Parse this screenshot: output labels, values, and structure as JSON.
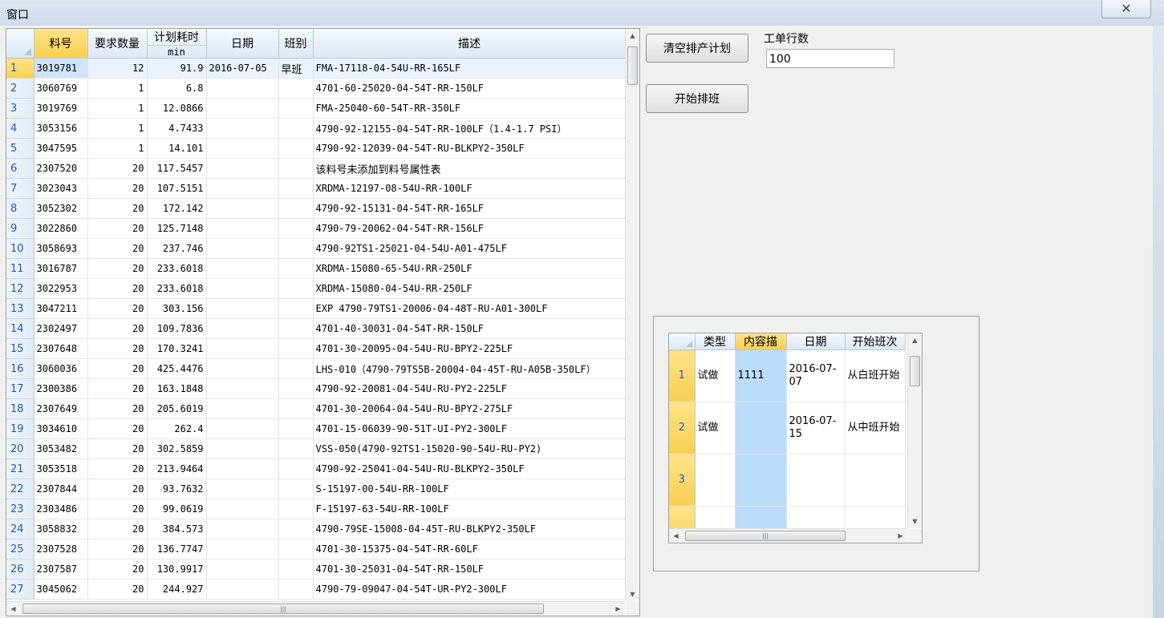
{
  "window": {
    "title": "窗口",
    "close_glyph": "✕"
  },
  "grid": {
    "headers": {
      "code": "料号",
      "qty": "要求数量",
      "time_top": "计划耗时",
      "time_unit": "min",
      "date": "日期",
      "shift": "班别",
      "desc": "描述"
    },
    "rows": [
      {
        "n": "1",
        "code": "3019781",
        "qty": "12",
        "time": "91.9",
        "date": "2016-07-05",
        "shift": "早班",
        "desc": "FMA-17118-04-54U-RR-165LF"
      },
      {
        "n": "2",
        "code": "3060769",
        "qty": "1",
        "time": "6.8",
        "date": "",
        "shift": "",
        "desc": "4701-60-25020-04-54T-RR-150LF"
      },
      {
        "n": "3",
        "code": "3019769",
        "qty": "1",
        "time": "12.0866",
        "date": "",
        "shift": "",
        "desc": "FMA-25040-60-54T-RR-350LF"
      },
      {
        "n": "4",
        "code": "3053156",
        "qty": "1",
        "time": "4.7433",
        "date": "",
        "shift": "",
        "desc": "4790-92-12155-04-54T-RR-100LF（1.4-1.7 PSI）"
      },
      {
        "n": "5",
        "code": "3047595",
        "qty": "1",
        "time": "14.101",
        "date": "",
        "shift": "",
        "desc": "4790-92-12039-04-54T-RU-BLKPY2-350LF"
      },
      {
        "n": "6",
        "code": "2307520",
        "qty": "20",
        "time": "117.5457",
        "date": "",
        "shift": "",
        "desc": "该料号未添加到料号属性表"
      },
      {
        "n": "7",
        "code": "3023043",
        "qty": "20",
        "time": "107.5151",
        "date": "",
        "shift": "",
        "desc": "XRDMA-12197-08-54U-RR-100LF"
      },
      {
        "n": "8",
        "code": "3052302",
        "qty": "20",
        "time": "172.142",
        "date": "",
        "shift": "",
        "desc": "4790-92-15131-04-54T-RR-165LF"
      },
      {
        "n": "9",
        "code": "3022860",
        "qty": "20",
        "time": "125.7148",
        "date": "",
        "shift": "",
        "desc": "4790-79-20062-04-54T-RR-156LF"
      },
      {
        "n": "10",
        "code": "3058693",
        "qty": "20",
        "time": "237.746",
        "date": "",
        "shift": "",
        "desc": "4790-92TS1-25021-04-54U-A01-475LF"
      },
      {
        "n": "11",
        "code": "3016787",
        "qty": "20",
        "time": "233.6018",
        "date": "",
        "shift": "",
        "desc": "XRDMA-15080-65-54U-RR-250LF"
      },
      {
        "n": "12",
        "code": "3022953",
        "qty": "20",
        "time": "233.6018",
        "date": "",
        "shift": "",
        "desc": "XRDMA-15080-04-54U-RR-250LF"
      },
      {
        "n": "13",
        "code": "3047211",
        "qty": "20",
        "time": "303.156",
        "date": "",
        "shift": "",
        "desc": "EXP 4790-79TS1-20006-04-48T-RU-A01-300LF"
      },
      {
        "n": "14",
        "code": "2302497",
        "qty": "20",
        "time": "109.7836",
        "date": "",
        "shift": "",
        "desc": "4701-40-30031-04-54T-RR-150LF"
      },
      {
        "n": "15",
        "code": "2307648",
        "qty": "20",
        "time": "170.3241",
        "date": "",
        "shift": "",
        "desc": "4701-30-20095-04-54U-RU-BPY2-225LF"
      },
      {
        "n": "16",
        "code": "3060036",
        "qty": "20",
        "time": "425.4476",
        "date": "",
        "shift": "",
        "desc": "LHS-010（4790-79TS5B-20004-04-45T-RU-A05B-350LF）"
      },
      {
        "n": "17",
        "code": "2300386",
        "qty": "20",
        "time": "163.1848",
        "date": "",
        "shift": "",
        "desc": "4790-92-20081-04-54U-RU-PY2-225LF"
      },
      {
        "n": "18",
        "code": "2307649",
        "qty": "20",
        "time": "205.6019",
        "date": "",
        "shift": "",
        "desc": "4701-30-20064-04-54U-RU-BPY2-275LF"
      },
      {
        "n": "19",
        "code": "3034610",
        "qty": "20",
        "time": "262.4",
        "date": "",
        "shift": "",
        "desc": "4701-15-06039-90-51T-UI-PY2-300LF"
      },
      {
        "n": "20",
        "code": "3053482",
        "qty": "20",
        "time": "302.5859",
        "date": "",
        "shift": "",
        "desc": "VSS-050(4790-92TS1-15020-90-54U-RU-PY2)"
      },
      {
        "n": "21",
        "code": "3053518",
        "qty": "20",
        "time": "213.9464",
        "date": "",
        "shift": "",
        "desc": "4790-92-25041-04-54U-RU-BLKPY2-350LF"
      },
      {
        "n": "22",
        "code": "2307844",
        "qty": "20",
        "time": "93.7632",
        "date": "",
        "shift": "",
        "desc": "S-15197-00-54U-RR-100LF"
      },
      {
        "n": "23",
        "code": "2303486",
        "qty": "20",
        "time": "99.0619",
        "date": "",
        "shift": "",
        "desc": "F-15197-63-54U-RR-100LF"
      },
      {
        "n": "24",
        "code": "3058832",
        "qty": "20",
        "time": "384.573",
        "date": "",
        "shift": "",
        "desc": "4790-79SE-15008-04-45T-RU-BLKPY2-350LF"
      },
      {
        "n": "25",
        "code": "2307528",
        "qty": "20",
        "time": "136.7747",
        "date": "",
        "shift": "",
        "desc": "4701-30-15375-04-54T-RR-60LF"
      },
      {
        "n": "26",
        "code": "2307587",
        "qty": "20",
        "time": "130.9917",
        "date": "",
        "shift": "",
        "desc": "4701-30-25031-04-54T-RR-150LF"
      },
      {
        "n": "27",
        "code": "3045062",
        "qty": "20",
        "time": "244.927",
        "date": "",
        "shift": "",
        "desc": "4790-79-09047-04-54T-UR-PY2-300LF"
      }
    ]
  },
  "controls": {
    "clear_btn": "清空排产计划",
    "start_btn": "开始排班",
    "rows_label": "工单行数",
    "rows_value": "100"
  },
  "grid2": {
    "headers": {
      "type": "类型",
      "content": "内容描",
      "date": "日期",
      "start": "开始班次"
    },
    "rows": [
      {
        "n": "1",
        "type": "试做",
        "content": "1111",
        "date": "2016-07-07",
        "start": "从白班开始"
      },
      {
        "n": "2",
        "type": "试做",
        "content": "",
        "date": "2016-07-15",
        "start": "从中班开始"
      },
      {
        "n": "3",
        "type": "",
        "content": "",
        "date": "",
        "start": ""
      },
      {
        "n": "",
        "type": "",
        "content": "",
        "date": "",
        "start": ""
      }
    ]
  },
  "scroll_glyphs": {
    "up": "▲",
    "down": "▼",
    "left": "◀",
    "right": "▶",
    "grip": "|||"
  },
  "colors": {
    "selection_header": "#f7cf4f",
    "selected_cell": "#cfe4fa",
    "highlight_column": "#bcdcfb",
    "row_number": "#1f5fa8"
  }
}
